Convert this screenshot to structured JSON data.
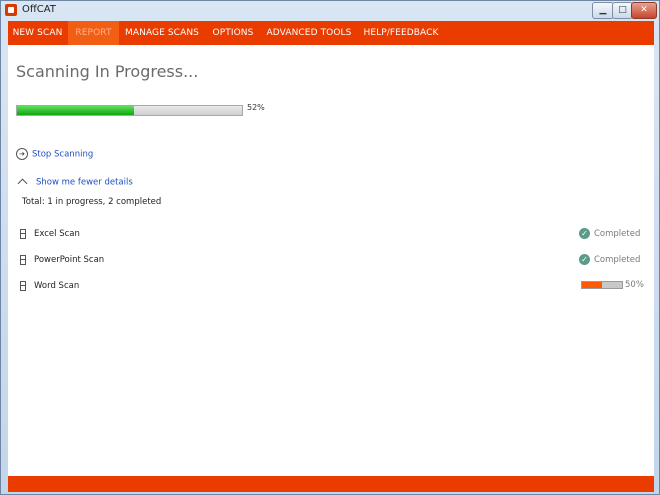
{
  "window": {
    "title": "OffCAT"
  },
  "titlebar": {
    "minimize_glyph": "▁",
    "maximize_glyph": "□",
    "close_glyph": "✕"
  },
  "menu": [
    {
      "label": "NEW SCAN"
    },
    {
      "label": "REPORT"
    },
    {
      "label": "MANAGE SCANS"
    },
    {
      "label": "OPTIONS"
    },
    {
      "label": "ADVANCED TOOLS"
    },
    {
      "label": "HELP/FEEDBACK"
    }
  ],
  "main": {
    "title": "Scanning In Progress...",
    "progress": {
      "value": 52,
      "label": "52%"
    },
    "stop_link": "Stop Scanning",
    "details_link": "Show me fewer details",
    "total": "Total: 1 in progress, 2 completed"
  },
  "scans": [
    {
      "name": "Excel Scan",
      "status": "Completed"
    },
    {
      "name": "PowerPoint Scan",
      "status": "Completed"
    },
    {
      "name": "Word Scan",
      "progress": 50,
      "progress_label": "50%"
    }
  ],
  "colors": {
    "brand": "#eb3c00",
    "active_tab_text": "#ffb28a",
    "progress_green": "#10a510",
    "status_check": "#5c9a8a",
    "link": "#1f4ec4"
  },
  "icons": {
    "stop": "circle-arrow-right-icon",
    "toggle": "chevron-up-icon",
    "scan_item": "document-icon",
    "completed": "check-circle-icon"
  }
}
